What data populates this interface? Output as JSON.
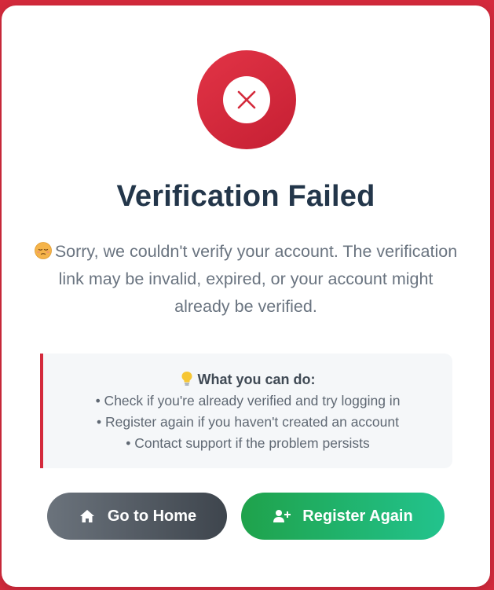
{
  "page": {
    "title": "Verification Failed",
    "message": "Sorry, we couldn't verify your account. The verification link may be invalid, expired, or your account might already be verified."
  },
  "tips": {
    "heading": "What you can do:",
    "items": [
      "• Check if you're already verified and try logging in",
      "• Register again if you haven't created an account",
      "• Contact support if the problem persists"
    ]
  },
  "buttons": {
    "home_label": "Go to Home",
    "register_label": "Register Again"
  },
  "colors": {
    "accent_red": "#d42a3c",
    "title": "#23364a",
    "home_button": "#4f565e",
    "register_button": "#22b36a"
  },
  "icons": {
    "status": "x-circle-icon",
    "message_emoji": "pensive-face-icon",
    "tip": "lightbulb-icon",
    "home": "home-icon",
    "register": "user-plus-icon"
  }
}
